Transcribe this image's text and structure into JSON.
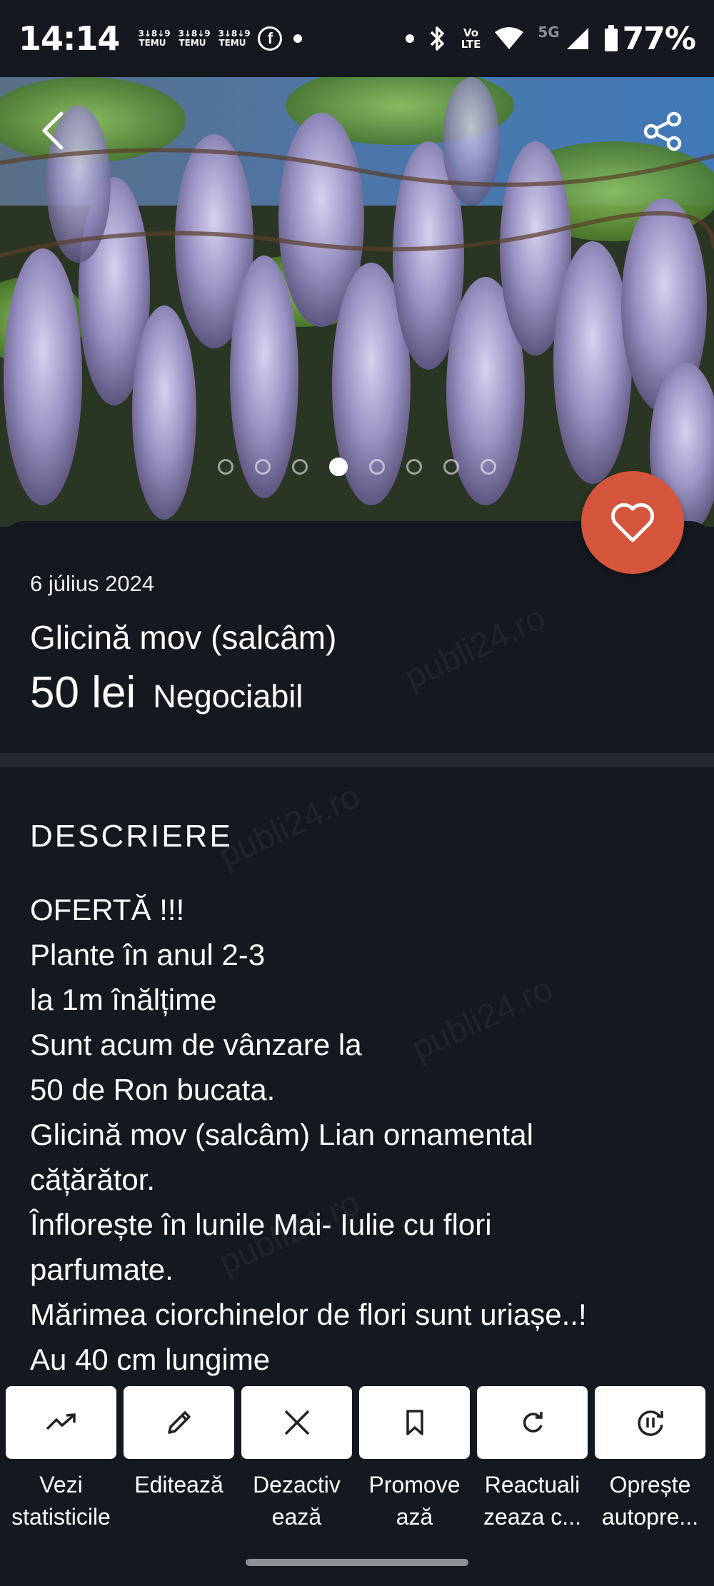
{
  "status_bar": {
    "time": "14:14",
    "notification_icons": [
      "temu-icon",
      "temu-icon",
      "temu-icon",
      "facebook-icon",
      "dot-icon"
    ],
    "temu_label_top": "3↓8↓9",
    "temu_label": "TEMU",
    "fb_label": "f",
    "volte_top": "Vo",
    "volte_bottom": "LTE",
    "network": "5G",
    "battery": "77%"
  },
  "hero": {
    "image_description_icon": "wisteria-photo",
    "page_count": 8,
    "active_page": 4
  },
  "listing": {
    "date": "6 július 2024",
    "title": "Glicină mov (salcâm)",
    "price": "50 lei",
    "price_note": "Negociabil"
  },
  "description": {
    "heading": "DESCRIERE",
    "lines": [
      "OFERTĂ !!!",
      "Plante în anul 2-3",
      "la 1m înălțime",
      "Sunt acum de vânzare la",
      "50 de Ron bucata.",
      "Glicină mov (salcâm) Lian ornamental",
      "cățărător.",
      "Înflorește în lunile Mai- Iulie cu flori",
      "parfumate.",
      "Mărimea ciorchinelor de flori sunt uriașe..!",
      "Au 40 cm lungime"
    ]
  },
  "watermark": "publi24.ro",
  "actions": [
    {
      "icon": "trending-up-icon",
      "line1": "Vezi",
      "line2": "statisticile"
    },
    {
      "icon": "pencil-icon",
      "line1": "Editează",
      "line2": ""
    },
    {
      "icon": "close-icon",
      "line1": "Dezactiv",
      "line2": "ează"
    },
    {
      "icon": "bookmark-icon",
      "line1": "Promove",
      "line2": "ază"
    },
    {
      "icon": "refresh-icon",
      "line1": "Reactuali",
      "line2": "zeaza c..."
    },
    {
      "icon": "pause-auto-icon",
      "line1": "Oprește",
      "line2": "autopre..."
    }
  ],
  "colors": {
    "background": "#14181f",
    "favorite": "#d5553c",
    "action_button": "#ffffff"
  }
}
